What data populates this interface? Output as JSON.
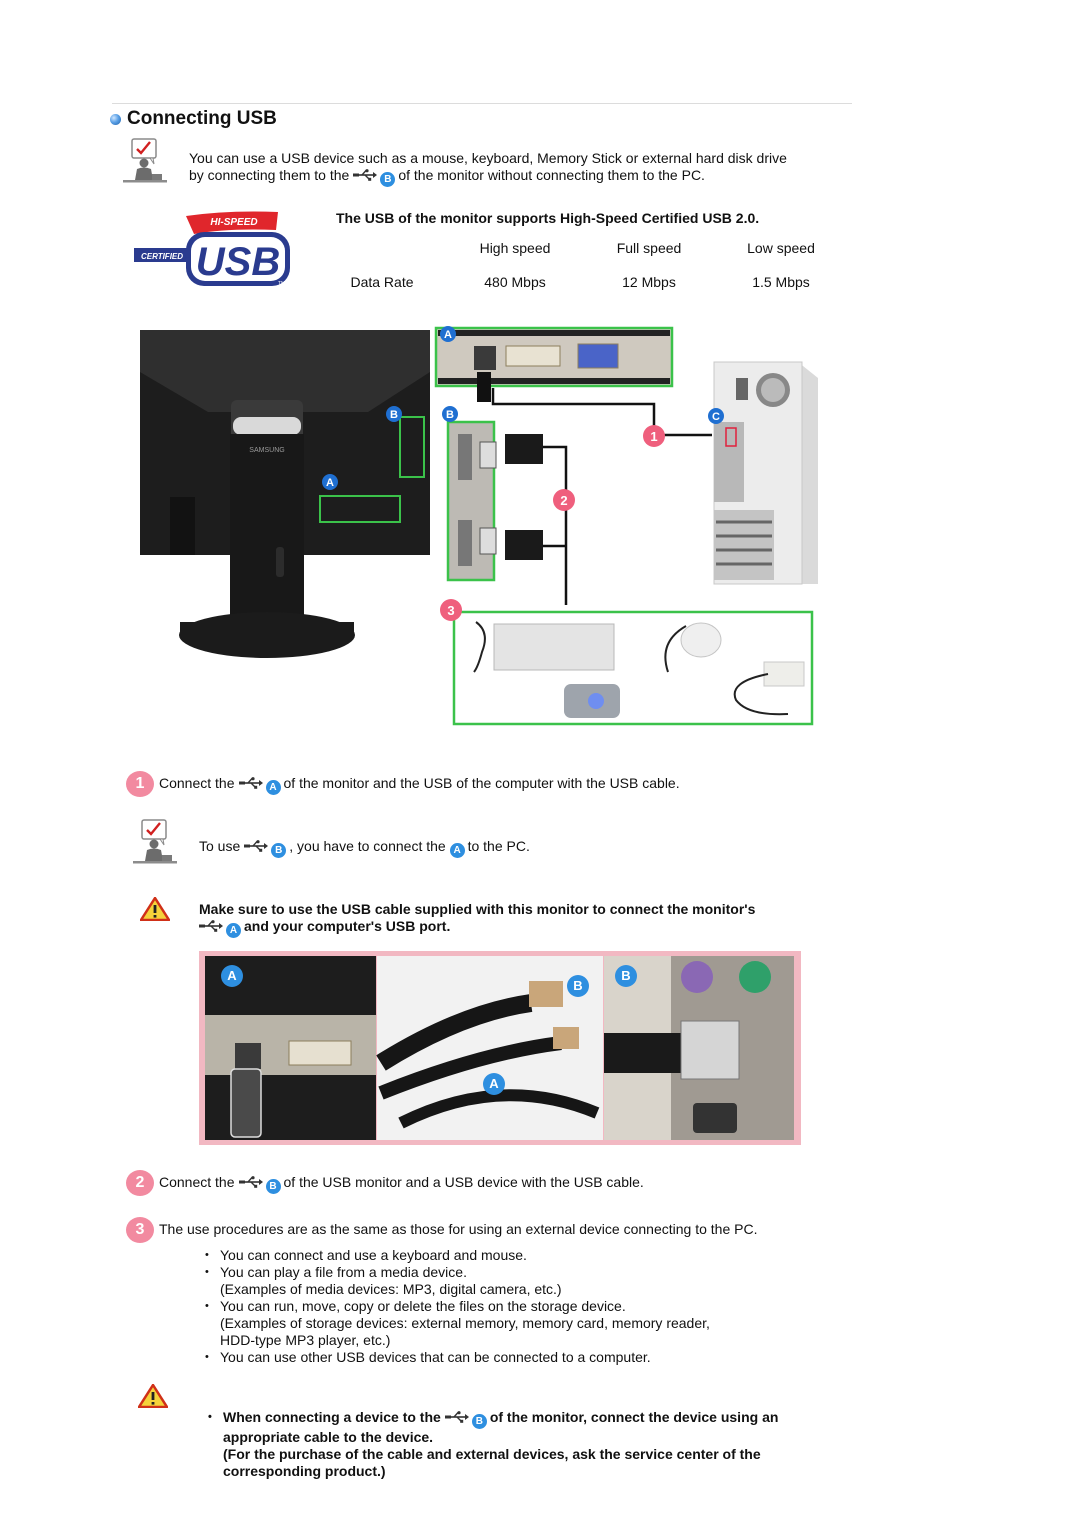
{
  "section": {
    "title": "Connecting USB"
  },
  "intro": {
    "line1": "You can use a USB device such as a mouse, keyboard, Memory Stick or external hard disk drive",
    "line2_pre": "by connecting them to the",
    "line2_letter": "B",
    "line2_post": "of the monitor without connecting them to the PC."
  },
  "usb_logo": {
    "top_text": "HI-SPEED",
    "side_text": "CERTIFIED",
    "main_text": "USB",
    "tm": "TM"
  },
  "speed_table": {
    "heading": "The USB of the monitor supports High-Speed Certified USB 2.0.",
    "columns": [
      "High speed",
      "Full speed",
      "Low speed"
    ],
    "rows": [
      {
        "label": "Data Rate",
        "values": [
          "480 Mbps",
          "12 Mbps",
          "1.5 Mbps"
        ]
      }
    ]
  },
  "diagram": {
    "labels": [
      "A",
      "B",
      "A",
      "B",
      "C"
    ],
    "steps": [
      "1",
      "2",
      "3"
    ],
    "brand": "SAMSUNG",
    "colors": {
      "frame": "#3bc24a",
      "letter_badge": "#1f6fd1",
      "step_badge": "#ef5f7d"
    }
  },
  "step1": {
    "number": "1",
    "pre": "Connect the",
    "letter": "A",
    "post": "of the monitor and the USB of the computer with the USB cable."
  },
  "note1": {
    "pre": "To use",
    "letter1": "B",
    "mid": ", you have to connect the",
    "letter2": "A",
    "post": "to the PC."
  },
  "warning1": {
    "line1": "Make sure to use the USB cable supplied with this monitor to connect the monitor's",
    "letter": "A",
    "line2": "and your computer's USB port."
  },
  "photo_strip": {
    "labels": [
      "A",
      "B",
      "A",
      "B"
    ],
    "border_color": "#f2b8c2"
  },
  "step2": {
    "number": "2",
    "pre": "Connect the",
    "letter": "B",
    "post": "of the USB monitor and a USB device with the USB cable."
  },
  "step3": {
    "number": "3",
    "text": "The use procedures are as the same as those for using an external device connecting to the PC.",
    "bullets": [
      {
        "lines": [
          "You can connect and use a keyboard and mouse."
        ]
      },
      {
        "lines": [
          "You can play a file from a media device.",
          "(Examples of media devices: MP3, digital camera, etc.)"
        ]
      },
      {
        "lines": [
          "You can run, move, copy or delete the files on the storage device.",
          "(Examples of storage devices: external memory, memory card, memory reader,",
          "HDD-type MP3 player, etc.)"
        ]
      },
      {
        "lines": [
          "You can use other USB devices that can be connected to a computer."
        ]
      }
    ]
  },
  "warning2": {
    "pre": "When connecting a device to the",
    "letter": "B",
    "post": "of the monitor, connect the device using an",
    "line2": "appropriate cable to the device.",
    "line3": "(For the purchase of the cable and external devices, ask the service center of the",
    "line4": "corresponding product.)"
  }
}
